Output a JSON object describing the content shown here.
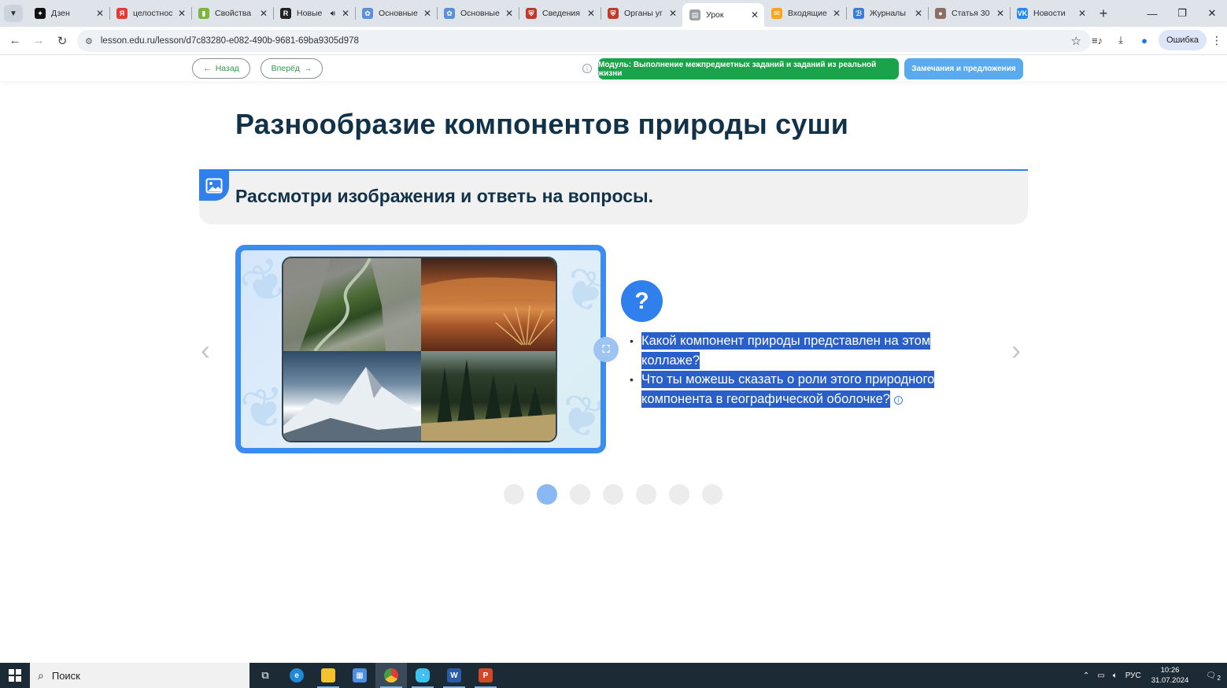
{
  "browser": {
    "tabs": [
      {
        "title": "Дзен",
        "favicon_color": "#111111",
        "favicon_glyph": "✦"
      },
      {
        "title": "целостнос",
        "favicon_color": "#e53935",
        "favicon_glyph": "Я"
      },
      {
        "title": "Свойства",
        "favicon_color": "#7cb342",
        "favicon_glyph": "▮"
      },
      {
        "title": "Новые",
        "favicon_color": "#222222",
        "favicon_glyph": "R",
        "audio": true
      },
      {
        "title": "Основные",
        "favicon_color": "#5c8fd6",
        "favicon_glyph": "✿"
      },
      {
        "title": "Основные",
        "favicon_color": "#5c8fd6",
        "favicon_glyph": "✿"
      },
      {
        "title": "Сведения",
        "favicon_color": "#c0392b",
        "favicon_glyph": "⛨"
      },
      {
        "title": "Органы уг",
        "favicon_color": "#c0392b",
        "favicon_glyph": "⛨"
      },
      {
        "title": "Урок",
        "favicon_color": "#9aa0a6",
        "favicon_glyph": "▤",
        "active": true
      },
      {
        "title": "Входящие",
        "favicon_color": "#f5a623",
        "favicon_glyph": "✉"
      },
      {
        "title": "Журналы",
        "favicon_color": "#3b7dd8",
        "favicon_glyph": "ℬ"
      },
      {
        "title": "Статья 30",
        "favicon_color": "#8d6e63",
        "favicon_glyph": "●"
      },
      {
        "title": "Новости",
        "favicon_color": "#2787f5",
        "favicon_glyph": "VK"
      }
    ],
    "url": "lesson.edu.ru/lesson/d7c83280-e082-490b-9681-69ba9305d978",
    "profile_label": "Ошибка"
  },
  "page": {
    "back_label": "Назад",
    "forward_label": "Вперёд",
    "module_label": "Модуль: Выполнение межпредметных заданий и заданий из реальной жизни",
    "notes_label": "Замечания и предложения",
    "title": "Разнообразие компонентов природы суши",
    "task_text": "Рассмотри изображения и ответь на вопросы.",
    "question_mark": "?",
    "questions": [
      "Какой компонент природы представлен на этом коллаже?",
      "Что ты можешь сказать о роли этого природного компонента в географической оболочке?"
    ],
    "slides": {
      "count": 7,
      "active_index": 1
    }
  },
  "taskbar": {
    "search_placeholder": "Поиск",
    "language": "РУС",
    "time": "10:26",
    "date": "31.07.2024",
    "notification_count": "2"
  }
}
